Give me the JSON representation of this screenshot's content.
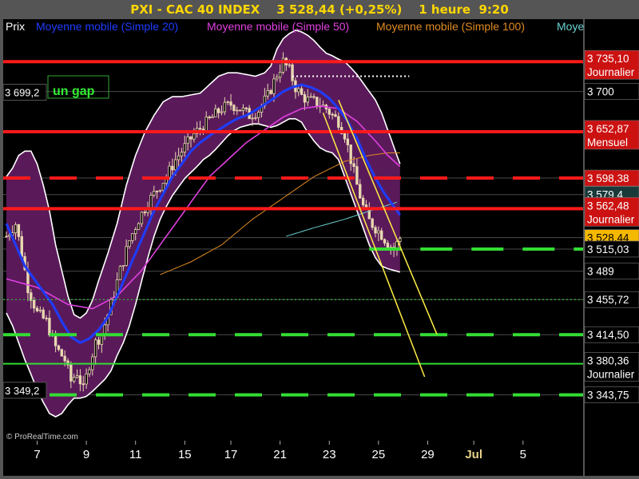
{
  "header": {
    "title": "PXI - CAC 40 INDEX",
    "price": "3 528,44",
    "change": "(+0,25%)",
    "interval": "1 heure",
    "time": "9:20"
  },
  "legend": [
    "Prix",
    "Moyenne mobile (Simple 20)",
    "Moyenne mobile (Simple 50)",
    "Moyenne mobile (Simple 100)",
    "Moye"
  ],
  "watermark": "© ProRealTime.com",
  "annotation_gap": "un gap",
  "left_labels": [
    {
      "text": "3 699,2",
      "value": 3699.2
    },
    {
      "text": "3 349,2",
      "value": 3349.2
    }
  ],
  "colors": {
    "sma20": "#1e3cff",
    "sma50": "#e040e0",
    "sma100": "#e08a20",
    "sma200": "#6ad0d0",
    "band_fill": "#5a1a5a",
    "band_edge": "#ffffff",
    "resistance": "#ff1a1a",
    "support": "#33dd33",
    "trend": "#ffee44",
    "candle": "#e8d8b0",
    "price_box": "#f5b800"
  },
  "chart_data": {
    "type": "candlestick",
    "instrument": "CAC 40 INDEX",
    "timeframe": "1 heure",
    "ylim": [
      3290,
      3785
    ],
    "x_ticks": [
      {
        "label": "7",
        "bar": 10
      },
      {
        "label": "9",
        "bar": 26
      },
      {
        "label": "11",
        "bar": 42
      },
      {
        "label": "15",
        "bar": 58
      },
      {
        "label": "17",
        "bar": 73
      },
      {
        "label": "21",
        "bar": 89
      },
      {
        "label": "23",
        "bar": 105
      },
      {
        "label": "25",
        "bar": 121
      },
      {
        "label": "29",
        "bar": 137
      },
      {
        "label": "Jul",
        "bar": 152,
        "bold": true
      },
      {
        "label": "5",
        "bar": 168
      }
    ],
    "close_anchors": [
      [
        0,
        3530
      ],
      [
        3,
        3545
      ],
      [
        5,
        3510
      ],
      [
        7,
        3470
      ],
      [
        10,
        3440
      ],
      [
        13,
        3430
      ],
      [
        16,
        3400
      ],
      [
        19,
        3385
      ],
      [
        21,
        3360
      ],
      [
        23,
        3370
      ],
      [
        25,
        3350
      ],
      [
        27,
        3380
      ],
      [
        29,
        3405
      ],
      [
        31,
        3415
      ],
      [
        34,
        3450
      ],
      [
        37,
        3490
      ],
      [
        40,
        3525
      ],
      [
        43,
        3550
      ],
      [
        46,
        3570
      ],
      [
        49,
        3585
      ],
      [
        52,
        3600
      ],
      [
        55,
        3620
      ],
      [
        58,
        3635
      ],
      [
        61,
        3650
      ],
      [
        64,
        3660
      ],
      [
        67,
        3670
      ],
      [
        70,
        3680
      ],
      [
        73,
        3685
      ],
      [
        76,
        3680
      ],
      [
        79,
        3672
      ],
      [
        82,
        3678
      ],
      [
        85,
        3695
      ],
      [
        88,
        3720
      ],
      [
        90,
        3735
      ],
      [
        92,
        3725
      ],
      [
        94,
        3705
      ],
      [
        96,
        3695
      ],
      [
        98,
        3690
      ],
      [
        100,
        3688
      ],
      [
        102,
        3685
      ],
      [
        104,
        3680
      ],
      [
        106,
        3672
      ],
      [
        108,
        3665
      ],
      [
        110,
        3650
      ],
      [
        112,
        3620
      ],
      [
        114,
        3590
      ],
      [
        116,
        3565
      ],
      [
        118,
        3548
      ],
      [
        120,
        3540
      ],
      [
        122,
        3532
      ],
      [
        124,
        3522
      ],
      [
        126,
        3515
      ],
      [
        128,
        3528
      ]
    ],
    "sma20_anchors": [
      [
        0,
        3545
      ],
      [
        3,
        3520
      ],
      [
        6,
        3495
      ],
      [
        9,
        3480
      ],
      [
        12,
        3465
      ],
      [
        15,
        3450
      ],
      [
        18,
        3430
      ],
      [
        21,
        3412
      ],
      [
        24,
        3405
      ],
      [
        27,
        3410
      ],
      [
        30,
        3420
      ],
      [
        33,
        3435
      ],
      [
        36,
        3460
      ],
      [
        39,
        3485
      ],
      [
        42,
        3510
      ],
      [
        45,
        3535
      ],
      [
        48,
        3560
      ],
      [
        51,
        3580
      ],
      [
        54,
        3600
      ],
      [
        57,
        3615
      ],
      [
        60,
        3630
      ],
      [
        63,
        3640
      ],
      [
        66,
        3648
      ],
      [
        69,
        3655
      ],
      [
        72,
        3662
      ],
      [
        75,
        3668
      ],
      [
        78,
        3672
      ],
      [
        81,
        3678
      ],
      [
        84,
        3685
      ],
      [
        87,
        3692
      ],
      [
        90,
        3700
      ],
      [
        93,
        3705
      ],
      [
        96,
        3708
      ],
      [
        99,
        3705
      ],
      [
        102,
        3700
      ],
      [
        105,
        3692
      ],
      [
        108,
        3680
      ],
      [
        111,
        3665
      ],
      [
        114,
        3645
      ],
      [
        117,
        3620
      ],
      [
        120,
        3598
      ],
      [
        123,
        3580
      ],
      [
        126,
        3565
      ],
      [
        128,
        3555
      ]
    ],
    "sma50_anchors": [
      [
        0,
        3480
      ],
      [
        10,
        3470
      ],
      [
        20,
        3450
      ],
      [
        28,
        3445
      ],
      [
        36,
        3460
      ],
      [
        44,
        3490
      ],
      [
        52,
        3530
      ],
      [
        60,
        3570
      ],
      [
        66,
        3600
      ],
      [
        72,
        3620
      ],
      [
        78,
        3640
      ],
      [
        84,
        3655
      ],
      [
        90,
        3670
      ],
      [
        96,
        3680
      ],
      [
        102,
        3683
      ],
      [
        108,
        3680
      ],
      [
        114,
        3665
      ],
      [
        120,
        3642
      ],
      [
        124,
        3625
      ],
      [
        128,
        3612
      ]
    ],
    "sma100_anchors": [
      [
        50,
        3485
      ],
      [
        60,
        3500
      ],
      [
        70,
        3520
      ],
      [
        80,
        3550
      ],
      [
        90,
        3575
      ],
      [
        100,
        3600
      ],
      [
        110,
        3618
      ],
      [
        118,
        3625
      ],
      [
        124,
        3628
      ],
      [
        128,
        3628
      ]
    ],
    "sma200_anchors": [
      [
        91,
        3530
      ],
      [
        100,
        3540
      ],
      [
        110,
        3550
      ],
      [
        120,
        3562
      ],
      [
        127,
        3570
      ]
    ],
    "band_upper_anchors": [
      [
        0,
        3600
      ],
      [
        2,
        3610
      ],
      [
        4,
        3625
      ],
      [
        6,
        3630
      ],
      [
        8,
        3630
      ],
      [
        10,
        3615
      ],
      [
        12,
        3590
      ],
      [
        14,
        3560
      ],
      [
        16,
        3520
      ],
      [
        18,
        3490
      ],
      [
        20,
        3460
      ],
      [
        22,
        3438
      ],
      [
        24,
        3434
      ],
      [
        26,
        3440
      ],
      [
        28,
        3455
      ],
      [
        30,
        3478
      ],
      [
        33,
        3510
      ],
      [
        36,
        3545
      ],
      [
        39,
        3590
      ],
      [
        42,
        3625
      ],
      [
        45,
        3652
      ],
      [
        48,
        3672
      ],
      [
        51,
        3688
      ],
      [
        54,
        3694
      ],
      [
        57,
        3694
      ],
      [
        60,
        3696
      ],
      [
        63,
        3698
      ],
      [
        66,
        3708
      ],
      [
        69,
        3718
      ],
      [
        72,
        3722
      ],
      [
        75,
        3722
      ],
      [
        78,
        3720
      ],
      [
        81,
        3718
      ],
      [
        84,
        3722
      ],
      [
        86,
        3730
      ],
      [
        88,
        3750
      ],
      [
        90,
        3762
      ],
      [
        92,
        3768
      ],
      [
        94,
        3772
      ],
      [
        96,
        3770
      ],
      [
        98,
        3766
      ],
      [
        100,
        3760
      ],
      [
        102,
        3752
      ],
      [
        104,
        3745
      ],
      [
        106,
        3742
      ],
      [
        108,
        3738
      ],
      [
        110,
        3735
      ],
      [
        112,
        3728
      ],
      [
        114,
        3720
      ],
      [
        116,
        3710
      ],
      [
        118,
        3700
      ],
      [
        120,
        3690
      ],
      [
        122,
        3675
      ],
      [
        124,
        3655
      ],
      [
        126,
        3635
      ],
      [
        128,
        3615
      ]
    ],
    "band_lower_anchors": [
      [
        0,
        3440
      ],
      [
        2,
        3425
      ],
      [
        4,
        3405
      ],
      [
        6,
        3385
      ],
      [
        8,
        3368
      ],
      [
        10,
        3350
      ],
      [
        12,
        3335
      ],
      [
        14,
        3322
      ],
      [
        16,
        3318
      ],
      [
        18,
        3322
      ],
      [
        20,
        3332
      ],
      [
        22,
        3340
      ],
      [
        24,
        3340
      ],
      [
        26,
        3342
      ],
      [
        28,
        3348
      ],
      [
        30,
        3355
      ],
      [
        32,
        3362
      ],
      [
        34,
        3372
      ],
      [
        36,
        3390
      ],
      [
        38,
        3405
      ],
      [
        40,
        3425
      ],
      [
        42,
        3450
      ],
      [
        44,
        3478
      ],
      [
        46,
        3505
      ],
      [
        48,
        3530
      ],
      [
        50,
        3550
      ],
      [
        52,
        3565
      ],
      [
        54,
        3578
      ],
      [
        56,
        3588
      ],
      [
        58,
        3598
      ],
      [
        60,
        3605
      ],
      [
        62,
        3612
      ],
      [
        64,
        3620
      ],
      [
        66,
        3625
      ],
      [
        68,
        3632
      ],
      [
        70,
        3640
      ],
      [
        72,
        3648
      ],
      [
        74,
        3654
      ],
      [
        76,
        3658
      ],
      [
        78,
        3660
      ],
      [
        80,
        3662
      ],
      [
        82,
        3662
      ],
      [
        84,
        3660
      ],
      [
        86,
        3658
      ],
      [
        88,
        3660
      ],
      [
        90,
        3664
      ],
      [
        92,
        3668
      ],
      [
        94,
        3668
      ],
      [
        96,
        3664
      ],
      [
        98,
        3652
      ],
      [
        100,
        3642
      ],
      [
        102,
        3634
      ],
      [
        104,
        3630
      ],
      [
        106,
        3628
      ],
      [
        108,
        3620
      ],
      [
        110,
        3600
      ],
      [
        112,
        3580
      ],
      [
        114,
        3560
      ],
      [
        116,
        3540
      ],
      [
        118,
        3520
      ],
      [
        120,
        3505
      ],
      [
        122,
        3495
      ],
      [
        124,
        3492
      ],
      [
        126,
        3490
      ],
      [
        128,
        3488
      ]
    ],
    "horizontal_levels": [
      {
        "value": 3735.1,
        "label": "3 735,10",
        "sublabel": "Journalier",
        "style": "solid",
        "color": "red",
        "box": "#cc1111"
      },
      {
        "value": 3700.0,
        "label": "3 700",
        "style": "grid"
      },
      {
        "value": 3652.87,
        "label": "3 652,87",
        "sublabel": "Mensuel",
        "style": "solid",
        "color": "red",
        "box": "#cc1111"
      },
      {
        "value": 3598.38,
        "label": "3 598,38",
        "style": "dashed",
        "color": "red",
        "box": "#cc1111"
      },
      {
        "value": 3579.0,
        "label": "3 579,4",
        "style": "none",
        "box": "#1a3a3a"
      },
      {
        "value": 3562.48,
        "label": "3 562,48",
        "sublabel": "Journalier",
        "style": "solid",
        "color": "red",
        "box": "#cc1111"
      },
      {
        "value": 3528.44,
        "label": "3 528,44",
        "style": "none",
        "box": "#f5b800",
        "textColor": "#000000"
      },
      {
        "value": 3515.03,
        "label": "3 515,03",
        "style": "dashed-short",
        "color": "green",
        "box": "#000000",
        "fromBar": 118
      },
      {
        "value": 3489.0,
        "label": "3 489",
        "style": "none",
        "box": "#000000"
      },
      {
        "value": 3455.72,
        "label": "3 455,72",
        "style": "dotted",
        "color": "green",
        "box": "#000000"
      },
      {
        "value": 3414.5,
        "label": "3 414,50",
        "style": "dashed",
        "color": "green",
        "box": "#000000"
      },
      {
        "value": 3380.36,
        "label": "3 380,36",
        "sublabel": "Journalier",
        "style": "solid",
        "color": "green",
        "box": "#000000"
      },
      {
        "value": 3343.75,
        "label": "3 343,75",
        "style": "dashed",
        "color": "green",
        "box": "#000000"
      }
    ],
    "gap_level": {
      "value": 3718,
      "fromBar": 93,
      "toBar": 131
    },
    "trend_lines": [
      {
        "from": [
          103,
          3675
        ],
        "to": [
          136,
          3365
        ]
      },
      {
        "from": [
          108,
          3690
        ],
        "to": [
          140,
          3415
        ]
      }
    ]
  }
}
